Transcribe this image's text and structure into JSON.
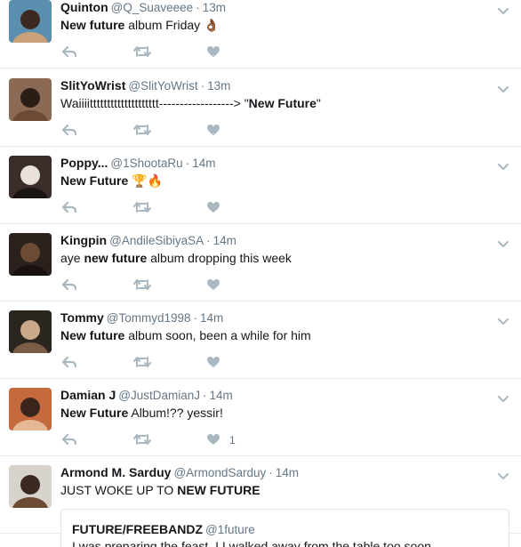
{
  "tweets": [
    {
      "name": "Quinton",
      "handle": "@Q_Suaveeee",
      "sep": "·",
      "time": "13m",
      "text_parts": [
        [
          "b",
          "New future"
        ],
        [
          "t",
          " album Friday "
        ]
      ],
      "emoji": "👌🏾",
      "likes": ""
    },
    {
      "name": "SlitYoWrist",
      "handle": "@SlitYoWrist",
      "sep": "·",
      "time": "13m",
      "text_parts": [
        [
          "t",
          "Waiiiitttttttttttttttttttt------------------> \""
        ],
        [
          "b",
          "New Future"
        ],
        [
          "t",
          "\""
        ]
      ],
      "emoji": "",
      "likes": ""
    },
    {
      "name": "Poppy...",
      "handle": "@1ShootaRu",
      "sep": "·",
      "time": "14m",
      "text_parts": [
        [
          "b",
          "New Future"
        ],
        [
          "t",
          " "
        ]
      ],
      "emoji": "🏆🔥",
      "likes": ""
    },
    {
      "name": "Kingpin",
      "handle": "@AndileSibiyaSA",
      "sep": "·",
      "time": "14m",
      "text_parts": [
        [
          "t",
          "aye "
        ],
        [
          "b",
          "new future"
        ],
        [
          "t",
          " album dropping this week"
        ]
      ],
      "emoji": "",
      "likes": ""
    },
    {
      "name": "Tommy",
      "handle": "@Tommyd1998",
      "sep": "·",
      "time": "14m",
      "text_parts": [
        [
          "b",
          "New future"
        ],
        [
          "t",
          " album soon, been a while for him"
        ]
      ],
      "emoji": "",
      "likes": ""
    },
    {
      "name": "Damian J",
      "handle": "@JustDamianJ",
      "sep": "·",
      "time": "14m",
      "text_parts": [
        [
          "b",
          "New Future"
        ],
        [
          "t",
          " Album!?? yessir!"
        ]
      ],
      "emoji": "",
      "likes": "1"
    },
    {
      "name": "Armond M. Sarduy",
      "handle": "@ArmondSarduy",
      "sep": "·",
      "time": "14m",
      "text_parts": [
        [
          "t",
          "JUST WOKE UP TO "
        ],
        [
          "b",
          "NEW FUTURE"
        ]
      ],
      "emoji": "",
      "likes": ""
    }
  ],
  "quote": {
    "name": "FUTURE/FREEBANDZ",
    "handle": "@1future",
    "text": "I was preparing the feast, I I walked away from the table too soon"
  },
  "icons": {
    "reply": "reply-icon",
    "retweet": "retweet-icon",
    "like": "heart-icon",
    "menu": "chevron-down-icon"
  },
  "colors": {
    "icon": "#aab8c2",
    "secondary_text": "#657786",
    "divider": "#e6ecf0"
  }
}
